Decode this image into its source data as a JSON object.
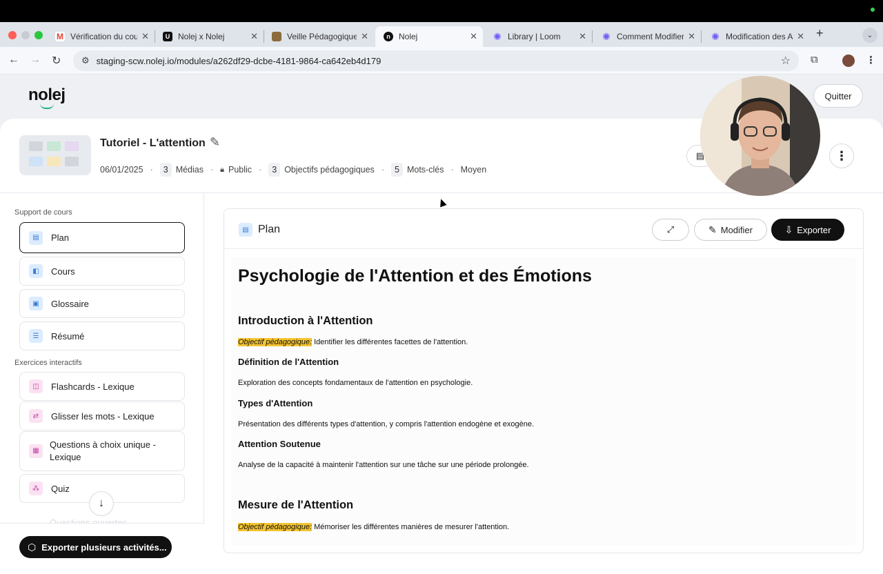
{
  "browser": {
    "tabs": [
      {
        "title": "Vérification du cours",
        "icon": "gmail-icon",
        "color": "#ea4335"
      },
      {
        "title": "Nolej x Nolej",
        "icon": "app-icon",
        "color": "#111111"
      },
      {
        "title": "Veille Pédagogique",
        "icon": "bottle-icon",
        "color": "#8b6b3d"
      },
      {
        "title": "Nolej",
        "icon": "nolej-icon",
        "color": "#111111",
        "active": true
      },
      {
        "title": "Library | Loom",
        "icon": "loom-icon",
        "color": "#6d5cf5"
      },
      {
        "title": "Comment Modifier l",
        "icon": "loom-icon",
        "color": "#6d5cf5"
      },
      {
        "title": "Modification des Ac",
        "icon": "loom-icon",
        "color": "#6d5cf5"
      }
    ],
    "url": "staging-scw.nolej.io/modules/a262df29-dcbe-4181-9864-ca642eb4d179"
  },
  "header": {
    "logo": "nolej",
    "quit_label": "Quitter"
  },
  "module": {
    "title": "Tutoriel - L'attention",
    "date": "06/01/2025",
    "medias_count": "3",
    "medias_label": "Médias",
    "visibility": "Public",
    "objectives_count": "3",
    "objectives_label": "Objectifs pédagogiques",
    "keywords_count": "5",
    "keywords_label": "Mots-clés",
    "level": "Moyen"
  },
  "sidebar": {
    "support_label": "Support de cours",
    "support_items": [
      "Plan",
      "Cours",
      "Glossaire",
      "Résumé"
    ],
    "exercises_label": "Exercices interactifs",
    "exercise_items": [
      "Flashcards - Lexique",
      "Glisser les mots - Lexique",
      "Questions à choix unique - Lexique",
      "Quiz"
    ],
    "faded_item": "Questions ouvertes",
    "export_multi": "Exporter plusieurs activités..."
  },
  "panel": {
    "title": "Plan",
    "modify_label": "Modifier",
    "export_label": "Exporter"
  },
  "document": {
    "h1": "Psychologie de l'Attention et des Émotions",
    "section1": {
      "title": "Introduction à l'Attention",
      "objective_label": "Objectif pédagogique:",
      "objective_text": " Identifier les différentes facettes de l'attention.",
      "sub1_title": "Définition de l'Attention",
      "sub1_text": "Exploration des concepts fondamentaux de l'attention en psychologie.",
      "sub2_title": "Types d'Attention",
      "sub2_text": "Présentation des différents types d'attention, y compris l'attention endogène et exogène.",
      "sub3_title": "Attention Soutenue",
      "sub3_text": "Analyse de la capacité à maintenir l'attention sur une tâche sur une période prolongée."
    },
    "section2": {
      "title": "Mesure de l'Attention",
      "objective_label": "Objectif pédagogique:",
      "objective_text": " Mémoriser les différentes manières de mesurer l'attention."
    }
  }
}
